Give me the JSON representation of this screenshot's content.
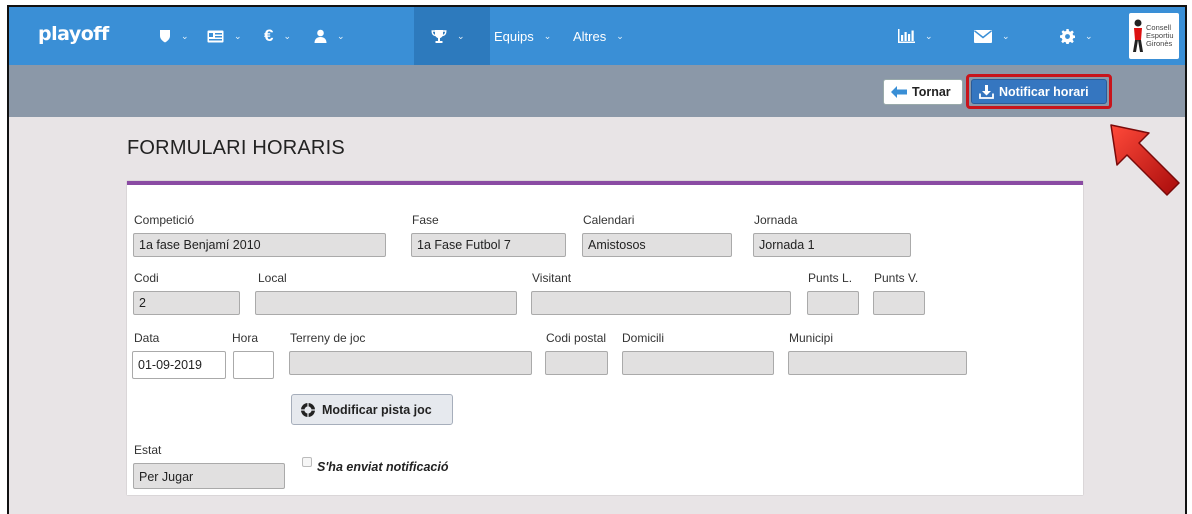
{
  "navbar": {
    "brand": "playoff",
    "items": [
      {
        "icon": "shield-icon"
      },
      {
        "icon": "id-card-icon"
      },
      {
        "icon": "euro-icon",
        "glyph": "€"
      },
      {
        "icon": "user-icon"
      },
      {
        "icon": "trophy-icon"
      },
      {
        "label": "Equips"
      },
      {
        "label": "Altres"
      }
    ],
    "right": [
      {
        "icon": "bar-chart-icon"
      },
      {
        "icon": "envelope-icon"
      },
      {
        "icon": "gear-icon"
      }
    ],
    "org_logo": "Consell Esportiu Gironès",
    "org_logo_lines": [
      "Consell",
      "Esportiu",
      "Gironès"
    ]
  },
  "toolbar": {
    "back_label": "Tornar",
    "notify_label": "Notificar horari"
  },
  "page": {
    "title": "FORMULARI HORARIS"
  },
  "form": {
    "competicio": {
      "label": "Competició",
      "value": "1a fase Benjamí 2010"
    },
    "fase": {
      "label": "Fase",
      "value": "1a Fase  Futbol 7"
    },
    "calendari": {
      "label": "Calendari",
      "value": "Amistosos"
    },
    "jornada": {
      "label": "Jornada",
      "value": "Jornada 1"
    },
    "codi": {
      "label": "Codi",
      "value": "2"
    },
    "local": {
      "label": "Local",
      "value": ""
    },
    "visitant": {
      "label": "Visitant",
      "value": ""
    },
    "punts_l": {
      "label": "Punts L.",
      "value": ""
    },
    "punts_v": {
      "label": "Punts V.",
      "value": ""
    },
    "data": {
      "label": "Data",
      "value": "01-09-2019"
    },
    "hora": {
      "label": "Hora",
      "value": ""
    },
    "terreny": {
      "label": "Terreny de joc",
      "value": ""
    },
    "codi_postal": {
      "label": "Codi postal",
      "value": ""
    },
    "domicili": {
      "label": "Domicili",
      "value": ""
    },
    "municipi": {
      "label": "Municipi",
      "value": ""
    },
    "modificar_label": "Modificar pista joc",
    "estat": {
      "label": "Estat",
      "value": "Per Jugar"
    },
    "notificacio_label": "S'ha enviat notificació",
    "notificacio_checked": false
  },
  "colors": {
    "navbar": "#3a8fd6",
    "toolbar": "#8b98a8",
    "accent_purple": "#8a4ba3",
    "notify_button": "#3576c0",
    "highlight_red": "#c8141b"
  }
}
